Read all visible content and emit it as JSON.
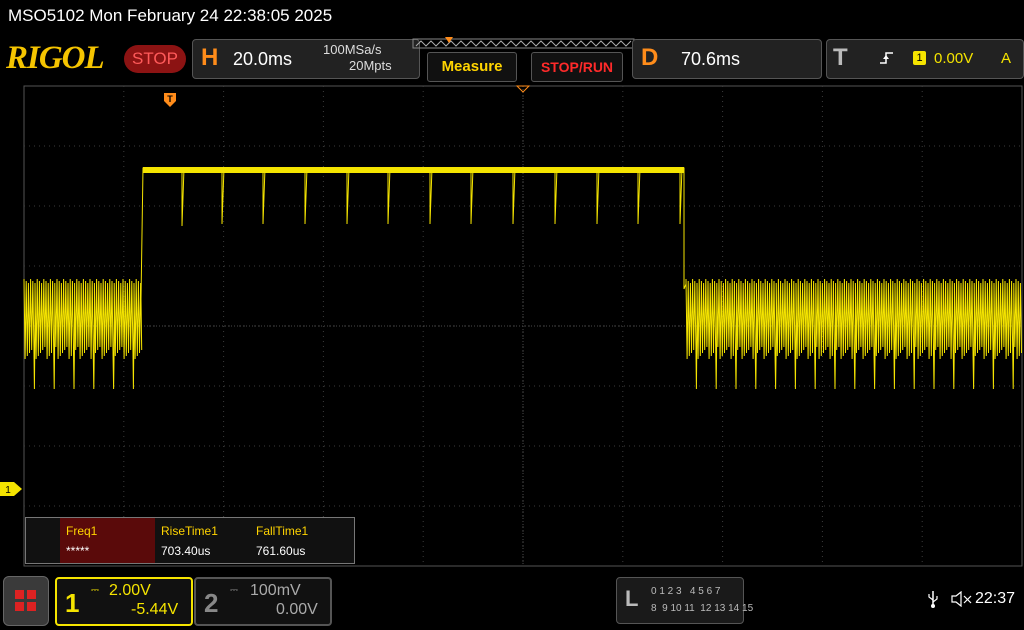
{
  "titlebar": {
    "text": "MSO5102  Mon February 24 22:38:05 2025"
  },
  "brand": {
    "logo": "RIGOL",
    "run_state": "STOP"
  },
  "horizontal": {
    "letter": "H",
    "timebase": "20.0ms",
    "sample_rate": "100MSa/s",
    "memory_depth": "20Mpts"
  },
  "buttons": {
    "measure": "Measure",
    "stop_run": "STOP/RUN"
  },
  "delay": {
    "letter": "D",
    "value": "70.6ms"
  },
  "trigger": {
    "letter": "T",
    "source": "1",
    "level": "0.00V",
    "mode": "A"
  },
  "channel1": {
    "number": "1",
    "scale": "2.00V",
    "offset": "-5.44V",
    "color": "#f5e400"
  },
  "channel2": {
    "number": "2",
    "scale": "100mV",
    "offset": "0.00V"
  },
  "la": {
    "letter": "L",
    "row1": "0 1 2 3   4 5 6 7",
    "row2": "8  9 10 11  12 13 14 15"
  },
  "status": {
    "time": "22:37"
  },
  "ch1_marker": "1",
  "measurements": [
    {
      "label": "Freq1",
      "value": "*****"
    },
    {
      "label": "RiseTime1",
      "value": "703.40us"
    },
    {
      "label": "FallTime1",
      "value": "761.60us"
    }
  ],
  "colors": {
    "trace": "#f5e400",
    "grid": "#3c3c3c",
    "accent": "#ff8c1a"
  }
}
